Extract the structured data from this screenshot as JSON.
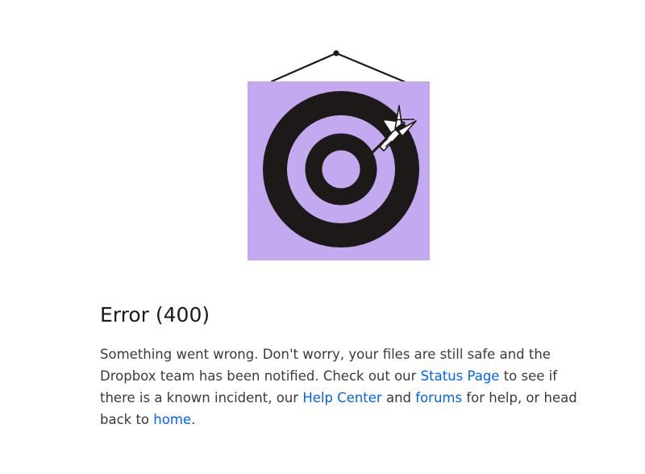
{
  "illustration": {
    "icon": "dartboard-poster-icon",
    "colors": {
      "poster_background": "#c3aaf0",
      "target": "#1e1919"
    }
  },
  "error": {
    "title": "Error (400)",
    "message": {
      "part1": "Something went wrong. Don't worry, your files are still safe and the Dropbox team has been notified. Check out our ",
      "status_page_link": "Status Page",
      "part2": " to see if there is a known incident, our ",
      "help_center_link": "Help Center",
      "part3": " and ",
      "forums_link": "forums",
      "part4": " for help, or head back to ",
      "home_link": "home",
      "part5": "."
    }
  },
  "theme": {
    "link_color": "#0061fe",
    "text_color": "#3d3a35",
    "title_color": "#1e1919"
  }
}
